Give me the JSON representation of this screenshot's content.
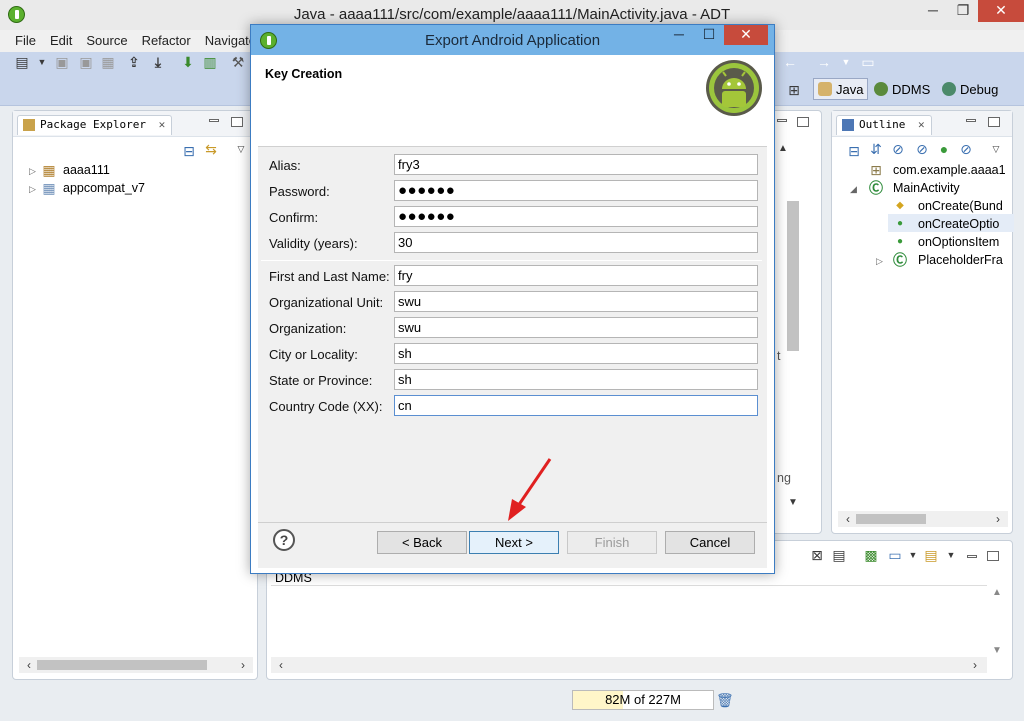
{
  "main_window": {
    "title": "Java - aaaa111/src/com/example/aaaa111/MainActivity.java - ADT",
    "menu": [
      "File",
      "Edit",
      "Source",
      "Refactor",
      "Navigate"
    ],
    "perspectives": [
      "Java",
      "DDMS",
      "Debug"
    ]
  },
  "package_explorer": {
    "tab_label": "Package Explorer",
    "items": [
      "aaaa111",
      "appcompat_v7"
    ]
  },
  "outline": {
    "tab_label": "Outline",
    "items": [
      "com.example.aaaa1",
      "MainActivity",
      "onCreate(Bund",
      "onCreateOptio",
      "onOptionsItem",
      "PlaceholderFra"
    ]
  },
  "console": {
    "text": "DDMS"
  },
  "editor_fragments": {
    "t": "t",
    "ng": "ng"
  },
  "status": {
    "heap": "82M of 227M",
    "heap_used_fraction": 0.36
  },
  "dialog": {
    "title": "Export Android Application",
    "section_title": "Key Creation",
    "fields": {
      "alias": {
        "label": "Alias:",
        "value": "fry3"
      },
      "password": {
        "label": "Password:",
        "value": "●●●●●●"
      },
      "confirm": {
        "label": "Confirm:",
        "value": "●●●●●●"
      },
      "validity": {
        "label": "Validity (years):",
        "value": "30"
      },
      "name": {
        "label": "First and Last Name:",
        "value": "fry"
      },
      "org_unit": {
        "label": "Organizational Unit:",
        "value": "swu"
      },
      "organization": {
        "label": "Organization:",
        "value": "swu"
      },
      "city": {
        "label": "City or Locality:",
        "value": "sh"
      },
      "state": {
        "label": "State or Province:",
        "value": "sh"
      },
      "country": {
        "label": "Country Code (XX):",
        "value": "cn"
      }
    },
    "buttons": {
      "help": "?",
      "back": "< Back",
      "next": "Next >",
      "finish": "Finish",
      "cancel": "Cancel"
    }
  }
}
